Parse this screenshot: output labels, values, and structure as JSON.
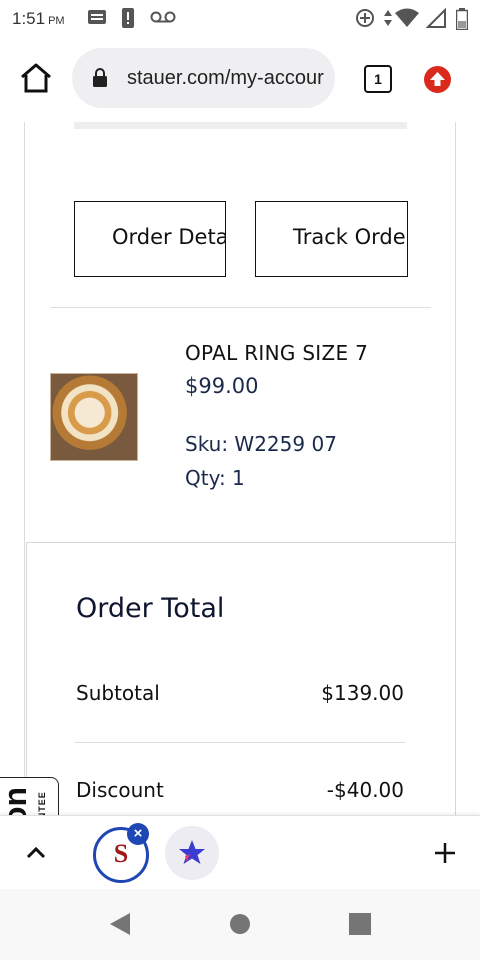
{
  "status_bar": {
    "time": "1:51",
    "ampm": "PM",
    "icons": [
      "notification-icon",
      "alert-icon",
      "voicemail-icon",
      "data-saver-icon",
      "data-arrows-icon",
      "wifi-icon",
      "signal-icon",
      "battery-icon"
    ]
  },
  "browser": {
    "url": "stauer.com/my-accour",
    "tab_count": "1",
    "icons": [
      "home-icon",
      "lock-icon",
      "tabs-icon",
      "upgrade-icon"
    ]
  },
  "order": {
    "buttons": {
      "order_details": "Order Details",
      "track_order": "Track Order"
    },
    "item": {
      "title": "OPAL RING SIZE 7",
      "price": "$99.00",
      "sku": "Sku: W2259 07",
      "qty": "Qty: 1"
    },
    "totals": {
      "heading": "Order Total",
      "subtotal_label": "Subtotal",
      "subtotal_value": "$139.00",
      "discount_label": "Discount",
      "discount_value": "-$40.00"
    }
  },
  "side_badge": {
    "big_text": "on",
    "small_text": "ANTEE"
  },
  "extensions": {
    "s_letter": "S",
    "close_glyph": "×",
    "icons": [
      "chevron-up-icon",
      "close-icon",
      "star-extension-icon",
      "plus-icon"
    ]
  },
  "colors": {
    "accent_blue": "#1e46b4",
    "upgrade_red": "#d92a1c",
    "price_navy": "#1b2a4a"
  }
}
